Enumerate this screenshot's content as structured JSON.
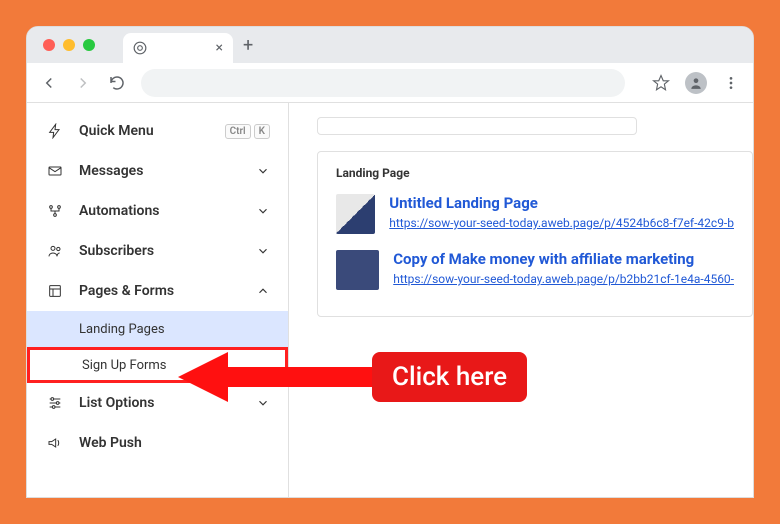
{
  "sidebar": {
    "items": [
      {
        "label": "Quick Menu",
        "kbd": [
          "Ctrl",
          "K"
        ]
      },
      {
        "label": "Messages"
      },
      {
        "label": "Automations"
      },
      {
        "label": "Subscribers"
      },
      {
        "label": "Pages & Forms",
        "expanded": true,
        "children": [
          {
            "label": "Landing Pages"
          },
          {
            "label": "Sign Up Forms"
          }
        ]
      },
      {
        "label": "List Options"
      },
      {
        "label": "Web Push"
      }
    ]
  },
  "main": {
    "section_title": "Landing Page",
    "pages": [
      {
        "title": "Untitled Landing Page",
        "url": "https://sow-your-seed-today.aweb.page/p/4524b6c8-f7ef-42c9-b"
      },
      {
        "title": "Copy of Make money with affiliate marketing",
        "url": "https://sow-your-seed-today.aweb.page/p/b2bb21cf-1e4a-4560-"
      }
    ]
  },
  "callout": {
    "text": "Click here"
  }
}
